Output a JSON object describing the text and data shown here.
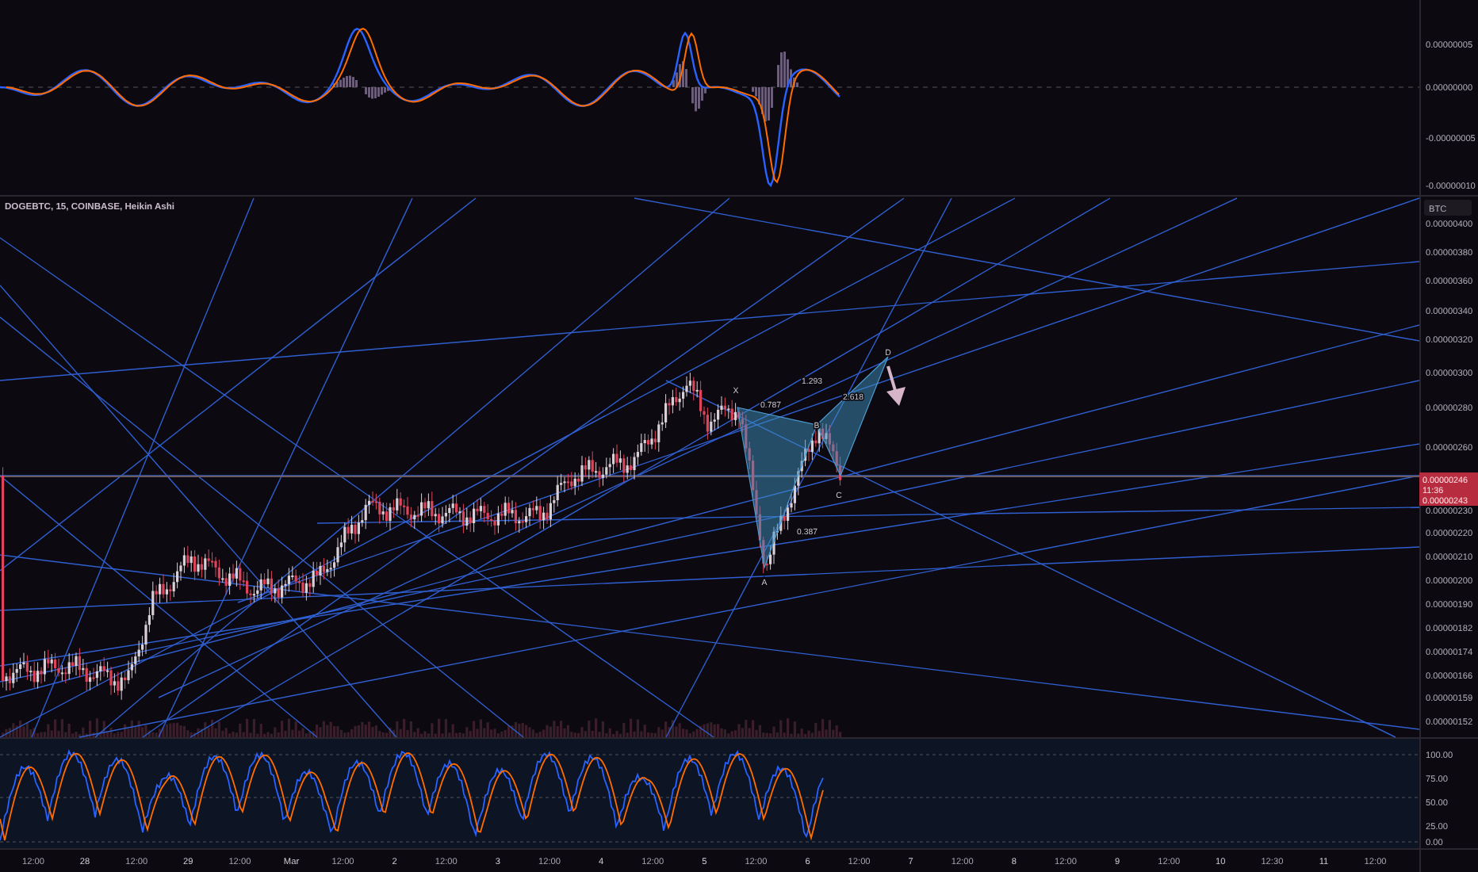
{
  "symbol_title": "DOGEBTC, 15, COINBASE, Heikin Ashi",
  "currency_badge": "BTC",
  "macd_axis_labels": [
    "0.00000005",
    "0.00000000",
    "-0.00000005",
    "-0.00000010"
  ],
  "price_axis_labels": [
    "0.00000400",
    "0.00000380",
    "0.00000360",
    "0.00000340",
    "0.00000320",
    "0.00000300",
    "0.00000280",
    "0.00000260",
    "0.00000230",
    "0.00000220",
    "0.00000210",
    "0.00000200",
    "0.00000190",
    "0.00000182",
    "0.00000174",
    "0.00000166",
    "0.00000159",
    "0.00000152"
  ],
  "price_label": {
    "price": "0.00000246",
    "countdown": "11:36",
    "line_price": "0.00000243"
  },
  "pattern": {
    "points": [
      "X",
      "A",
      "B",
      "C",
      "D"
    ],
    "ratios": [
      "1.293",
      "2.618",
      "0.787",
      "0.387"
    ]
  },
  "stoch_axis_labels": [
    "100.00",
    "75.00",
    "50.00",
    "25.00",
    "0.00"
  ],
  "time_axis_labels": [
    "12:00",
    "28",
    "12:00",
    "29",
    "12:00",
    "Mar",
    "12:00",
    "2",
    "12:00",
    "3",
    "12:00",
    "4",
    "12:00",
    "5",
    "12:00",
    "6",
    "12:00",
    "7",
    "12:00",
    "8",
    "12:00",
    "9",
    "12:00",
    "10",
    "12:30",
    "11",
    "12:00"
  ]
}
